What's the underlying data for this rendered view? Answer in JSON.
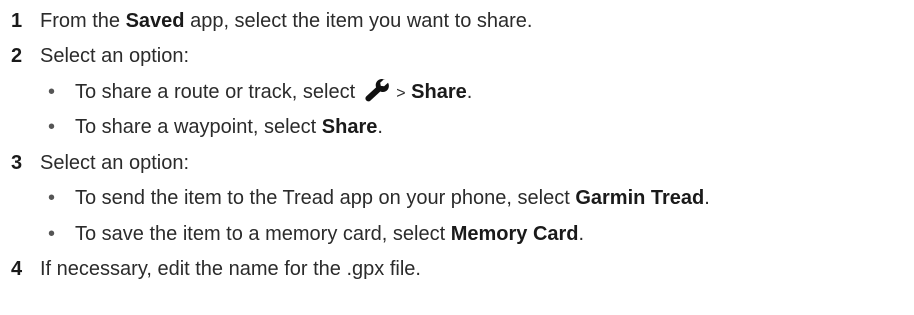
{
  "steps": [
    {
      "number": "1",
      "before": "From the ",
      "bold": "Saved",
      "after": " app, select the item you want to share."
    },
    {
      "number": "2",
      "text": "Select an option:",
      "options": [
        {
          "before": "To share a route or track, select ",
          "icon": "wrench-icon",
          "separator": ">",
          "bold": "Share",
          "after": "."
        },
        {
          "before": "To share a waypoint, select ",
          "bold": "Share",
          "after": "."
        }
      ]
    },
    {
      "number": "3",
      "text": "Select an option:",
      "options": [
        {
          "before": "To send the item to the Tread app on your phone, select ",
          "bold": "Garmin Tread",
          "after": "."
        },
        {
          "before": "To save the item to a memory card, select ",
          "bold": "Memory Card",
          "after": "."
        }
      ]
    },
    {
      "number": "4",
      "text": "If necessary, edit the name for the .gpx file."
    }
  ],
  "bullet_char": "•",
  "colors": {
    "text": "#2b2b2b",
    "bold": "#1a1a1a"
  }
}
